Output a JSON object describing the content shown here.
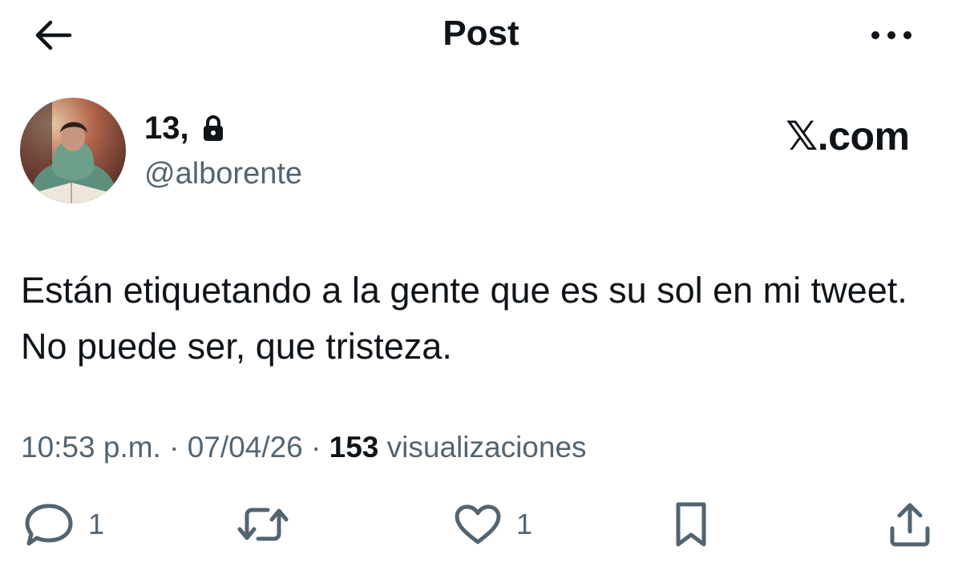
{
  "header": {
    "title": "Post",
    "back_icon": "arrow-left-icon",
    "more_icon": "ellipsis-horizontal-icon"
  },
  "author": {
    "display_name": "13,",
    "handle": "@alborente",
    "protected_icon": "lock-icon",
    "avatar": "avatar-photo"
  },
  "watermark": "𝕏.com",
  "tweet": {
    "text": "Están etiquetando a la gente que es su sol en mi tweet. No puede ser, que tristeza."
  },
  "meta": {
    "time": "10:53 p.m.",
    "separator": "·",
    "date": "07/04/26",
    "views_count": "153",
    "views_label": "visualizaciones"
  },
  "actions": {
    "reply": {
      "icon": "reply-icon",
      "count": "1"
    },
    "retweet": {
      "icon": "retweet-icon",
      "count": ""
    },
    "like": {
      "icon": "heart-icon",
      "count": "1"
    },
    "bookmark": {
      "icon": "bookmark-icon",
      "count": ""
    },
    "share": {
      "icon": "share-icon",
      "count": ""
    }
  },
  "colors": {
    "text_primary": "#0f1419",
    "text_secondary": "#536471",
    "background": "#ffffff"
  }
}
